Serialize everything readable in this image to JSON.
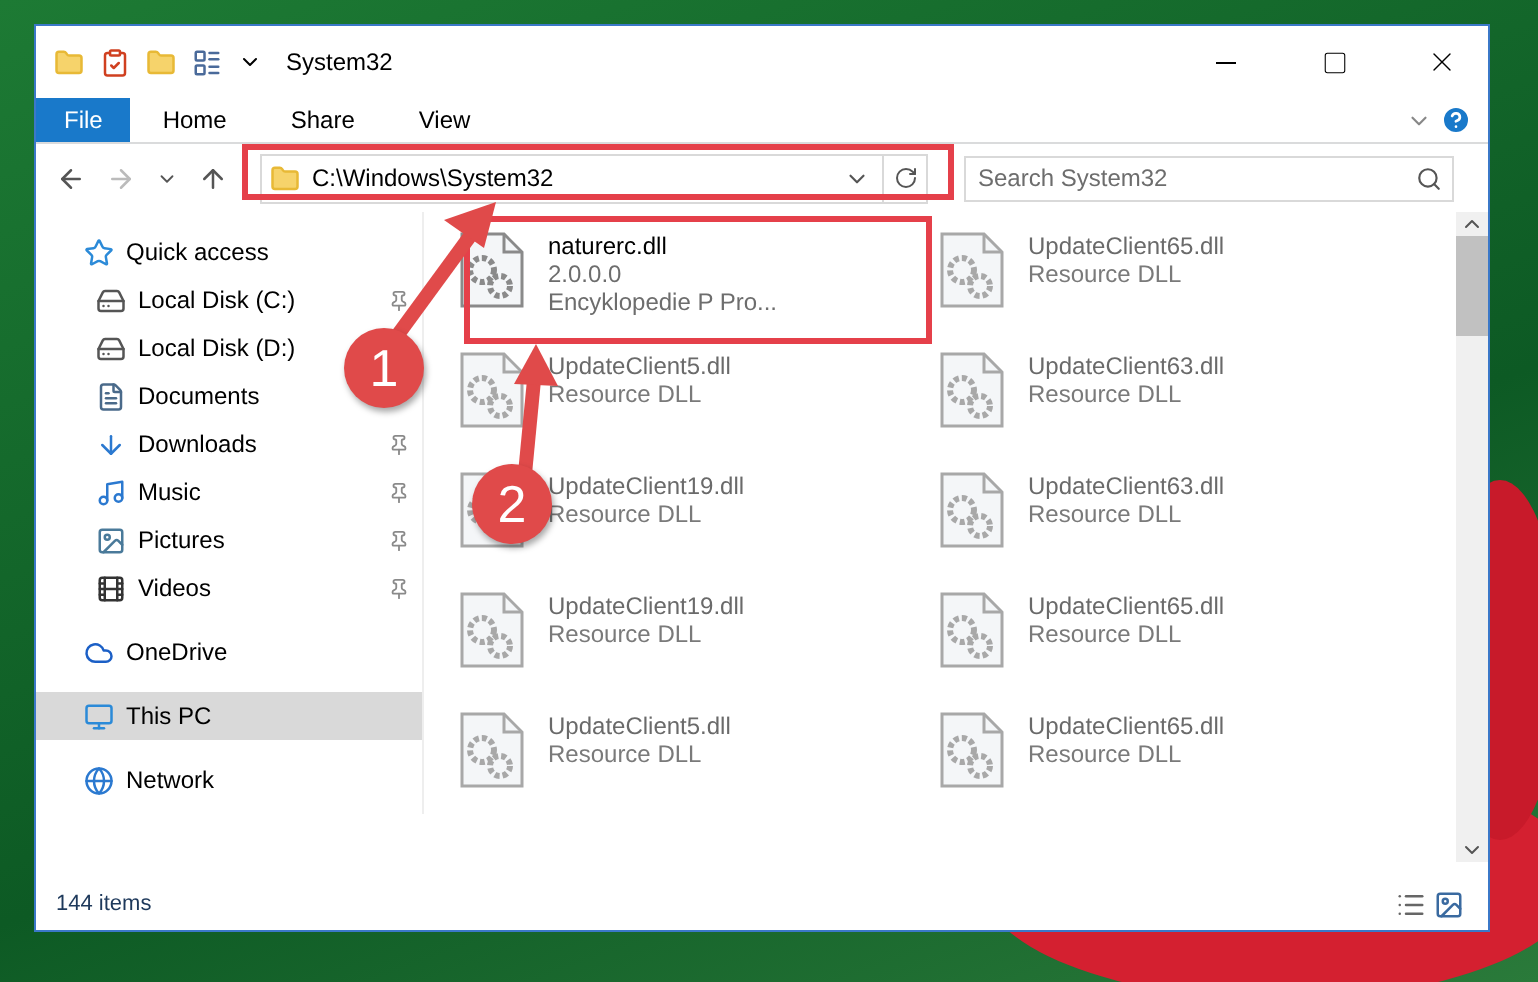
{
  "window": {
    "title": "System32"
  },
  "ribbon_tabs": [
    {
      "label": "File",
      "selected": true
    },
    {
      "label": "Home",
      "selected": false
    },
    {
      "label": "Share",
      "selected": false
    },
    {
      "label": "View",
      "selected": false
    }
  ],
  "address": "C:\\Windows\\System32",
  "search": {
    "placeholder": "Search System32"
  },
  "sidebar": {
    "items": [
      {
        "label": "Quick access",
        "selected": false,
        "pinned": false,
        "children": [
          {
            "label": "Local Disk (C:)",
            "selected": false,
            "pinned": true
          },
          {
            "label": "Local Disk (D:)",
            "selected": false,
            "pinned": false
          },
          {
            "label": "Documents",
            "selected": false,
            "pinned": false
          },
          {
            "label": "Downloads",
            "selected": false,
            "pinned": true
          },
          {
            "label": "Music",
            "selected": false,
            "pinned": true
          },
          {
            "label": "Pictures",
            "selected": false,
            "pinned": true
          },
          {
            "label": "Videos",
            "selected": false,
            "pinned": true
          }
        ]
      },
      {
        "label": "OneDrive",
        "selected": false,
        "pinned": false
      },
      {
        "label": "This PC",
        "selected": true,
        "pinned": false
      },
      {
        "label": "Network",
        "selected": false,
        "pinned": false
      }
    ]
  },
  "files": [
    {
      "name": "naturerc.dll",
      "lines": [
        "2.0.0.0",
        "Encyklopedie P  Pro..."
      ],
      "blurred": false
    },
    {
      "name": "UpdateClient65.dll",
      "lines": [
        "Resource DLL"
      ],
      "blurred": true
    },
    {
      "name": "UpdateClient5.dll",
      "lines": [
        "Resource DLL"
      ],
      "blurred": true
    },
    {
      "name": "UpdateClient63.dll",
      "lines": [
        "Resource DLL"
      ],
      "blurred": true
    },
    {
      "name": "UpdateClient19.dll",
      "lines": [
        "Resource DLL"
      ],
      "blurred": true
    },
    {
      "name": "UpdateClient63.dll",
      "lines": [
        "Resource DLL"
      ],
      "blurred": true
    },
    {
      "name": "UpdateClient19.dll",
      "lines": [
        "Resource DLL"
      ],
      "blurred": true
    },
    {
      "name": "UpdateClient65.dll",
      "lines": [
        "Resource DLL"
      ],
      "blurred": true
    },
    {
      "name": "UpdateClient5.dll",
      "lines": [
        "Resource DLL"
      ],
      "blurred": true
    },
    {
      "name": "UpdateClient65.dll",
      "lines": [
        "Resource DLL"
      ],
      "blurred": true
    }
  ],
  "status_bar": {
    "count": "144 items"
  },
  "annotations": [
    {
      "label": "1"
    },
    {
      "label": "2"
    }
  ]
}
